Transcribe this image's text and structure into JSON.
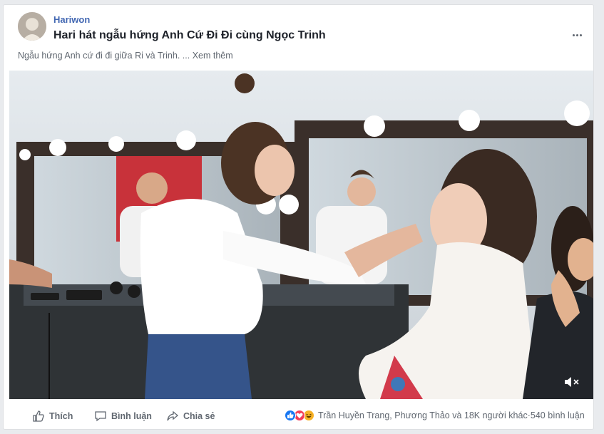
{
  "post": {
    "page_name": "Hariwon",
    "title": "Hari hát ngẫu hứng Anh Cứ Đi Đi cùng Ngọc Trinh",
    "description": "Ngẫu hứng Anh cứ đi đi giữa Ri và Trinh.",
    "ellipsis": " ... ",
    "see_more": "Xem thêm"
  },
  "actions": {
    "like": "Thích",
    "comment": "Bình luận",
    "share": "Chia sẻ"
  },
  "reactions": {
    "icons": [
      "like-icon",
      "love-icon",
      "haha-icon"
    ],
    "summary": "Trần Huyền Trang, Phương Thảo và 18K người khác",
    "separator": " · ",
    "comments": "540 bình luận"
  },
  "colors": {
    "brand": "#4267b2",
    "like": "#1877f2",
    "love": "#f33e58",
    "haha": "#f7b125"
  }
}
